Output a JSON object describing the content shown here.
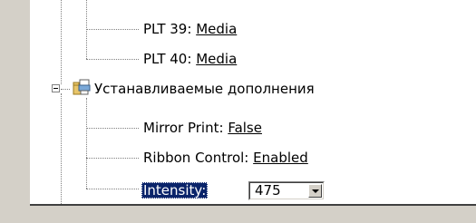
{
  "tree": {
    "rows": [
      {
        "label": "PLT 39:",
        "value": "Media"
      },
      {
        "label": "PLT 40:",
        "value": "Media"
      }
    ],
    "group": {
      "label": "Устанавливаемые дополнения",
      "icon": "printer-folder-icon",
      "children": [
        {
          "label": "Mirror Print:",
          "value": "False"
        },
        {
          "label": "Ribbon Control:",
          "value": "Enabled"
        }
      ],
      "selected": {
        "label": "Intensity:",
        "value": "475"
      }
    }
  },
  "colors": {
    "selection": "#0a246a",
    "background": "#d4d0c8"
  }
}
